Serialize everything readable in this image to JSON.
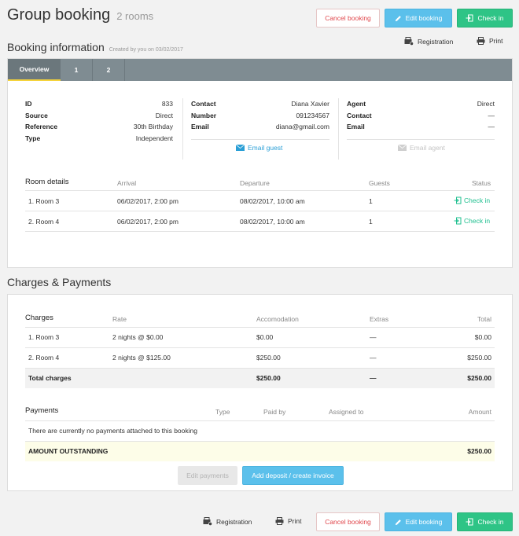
{
  "header": {
    "title": "Group booking",
    "subtitle": "2 rooms",
    "cancel_label": "Cancel booking",
    "edit_label": "Edit booking",
    "checkin_label": "Check in",
    "registration_label": "Registration",
    "print_label": "Print"
  },
  "booking_info": {
    "title": "Booking information",
    "created": "Created by you on 03/02/2017",
    "tabs": [
      "Overview",
      "1",
      "2"
    ],
    "details": {
      "id_label": "ID",
      "id_value": "833",
      "source_label": "Source",
      "source_value": "Direct",
      "reference_label": "Reference",
      "reference_value": "30th Birthday",
      "type_label": "Type",
      "type_value": "Independent"
    },
    "contact": {
      "contact_label": "Contact",
      "contact_value": "Diana Xavier",
      "number_label": "Number",
      "number_value": "091234567",
      "email_label": "Email",
      "email_value": "diana@gmail.com",
      "email_action": "Email guest"
    },
    "agent": {
      "agent_label": "Agent",
      "agent_value": "Direct",
      "contact_label": "Contact",
      "contact_value": "—",
      "email_label": "Email",
      "email_value": "—",
      "email_action": "Email agent"
    },
    "rooms": {
      "headers": [
        "Room details",
        "Arrival",
        "Departure",
        "Guests",
        "Status"
      ],
      "rows": [
        {
          "room": "1. Room 3",
          "arrival": "06/02/2017, 2:00 pm",
          "departure": "08/02/2017, 10:00 am",
          "guests": "1",
          "status": "Check in"
        },
        {
          "room": "2. Room 4",
          "arrival": "06/02/2017, 2:00 pm",
          "departure": "08/02/2017, 10:00 am",
          "guests": "1",
          "status": "Check in"
        }
      ]
    }
  },
  "charges": {
    "title": "Charges & Payments",
    "headers": [
      "Charges",
      "Rate",
      "Accomodation",
      "Extras",
      "Total"
    ],
    "rows": [
      {
        "name": "1. Room 3",
        "rate": "2 nights @ $0.00",
        "accom": "$0.00",
        "extras": "—",
        "total": "$0.00"
      },
      {
        "name": "2. Room 4",
        "rate": "2 nights @ $125.00",
        "accom": "$250.00",
        "extras": "—",
        "total": "$250.00"
      }
    ],
    "total_row": {
      "name": "Total charges",
      "accom": "$250.00",
      "extras": "—",
      "total": "$250.00"
    },
    "payments_headers": [
      "Payments",
      "Type",
      "Paid by",
      "Assigned to",
      "Amount"
    ],
    "no_payments": "There are currently no payments attached to this booking",
    "outstanding_label": "AMOUNT OUTSTANDING",
    "outstanding_value": "$250.00",
    "edit_payments_label": "Edit payments",
    "add_deposit_label": "Add deposit / create invoice"
  },
  "colors": {
    "accent_blue": "#5bc0eb",
    "accent_green": "#2ec486",
    "cancel_red": "#e0474c",
    "tab_bar": "#7f8c92",
    "highlight_yellow": "#fdfde8"
  }
}
